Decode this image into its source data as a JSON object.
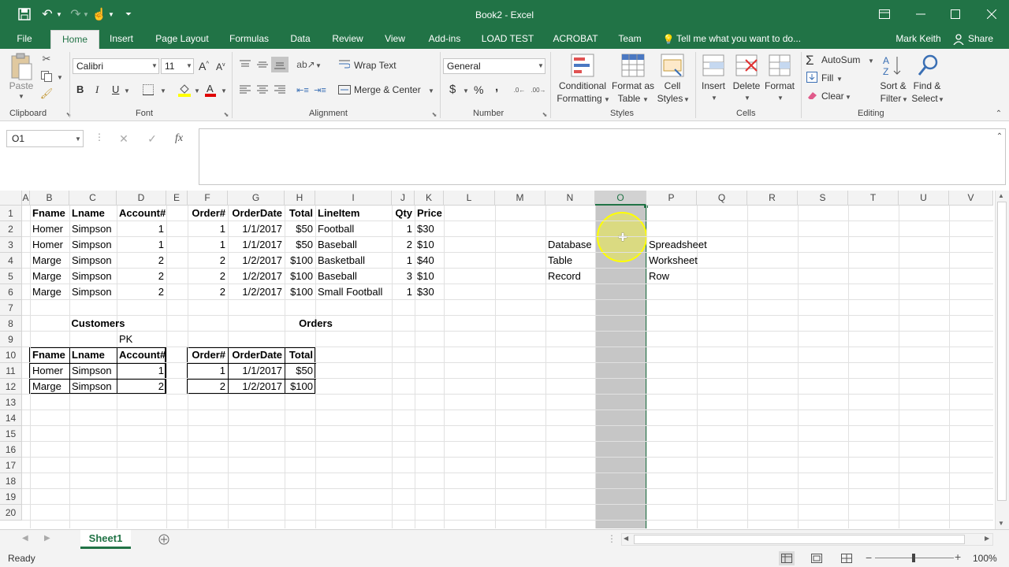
{
  "window": {
    "title": "Book2 - Excel",
    "user": "Mark Keith",
    "share": "Share"
  },
  "tabs": [
    "File",
    "Home",
    "Insert",
    "Page Layout",
    "Formulas",
    "Data",
    "Review",
    "View",
    "Add-ins",
    "LOAD TEST",
    "ACROBAT",
    "Team"
  ],
  "tell_me": "Tell me what you want to do...",
  "ribbon": {
    "clipboard": {
      "label": "Clipboard",
      "paste": "Paste"
    },
    "font": {
      "label": "Font",
      "name": "Calibri",
      "size": "11",
      "bold": "B",
      "italic": "I",
      "underline": "U"
    },
    "alignment": {
      "label": "Alignment",
      "wrap": "Wrap Text",
      "merge": "Merge & Center"
    },
    "number": {
      "label": "Number",
      "format": "General",
      "currency": "$",
      "percent": "%",
      "comma": ","
    },
    "styles": {
      "label": "Styles",
      "cond1": "Conditional",
      "cond2": "Formatting",
      "fmt1": "Format as",
      "fmt2": "Table",
      "cell1": "Cell",
      "cell2": "Styles"
    },
    "cells": {
      "label": "Cells",
      "insert": "Insert",
      "delete": "Delete",
      "format": "Format"
    },
    "editing": {
      "label": "Editing",
      "autosum": "AutoSum",
      "fill": "Fill",
      "clear": "Clear",
      "sort1": "Sort &",
      "sort2": "Filter",
      "find1": "Find &",
      "find2": "Select"
    }
  },
  "formula_bar": {
    "name_box": "O1",
    "fx": "fx",
    "value": ""
  },
  "columns": [
    "A",
    "B",
    "C",
    "D",
    "E",
    "F",
    "G",
    "H",
    "I",
    "J",
    "K",
    "L",
    "M",
    "N",
    "O",
    "P",
    "Q",
    "R",
    "S",
    "T",
    "U",
    "V"
  ],
  "rows": [
    "1",
    "2",
    "3",
    "4",
    "5",
    "6",
    "7",
    "8",
    "9",
    "10",
    "11",
    "12",
    "13",
    "14",
    "15",
    "16",
    "17",
    "18",
    "19",
    "20"
  ],
  "cells": {
    "B1": "Fname",
    "C1": "Lname",
    "D1": "Account#",
    "F1": "Order#",
    "G1": "OrderDate",
    "H1": "Total",
    "I1": "LineItem",
    "J1": "Qty",
    "K1": "Price",
    "B2": "Homer",
    "C2": "Simpson",
    "D2": "1",
    "F2": "1",
    "G2": "1/1/2017",
    "H2": "$50",
    "I2": "Football",
    "J2": "1",
    "K2": "$30",
    "B3": "Homer",
    "C3": "Simpson",
    "D3": "1",
    "F3": "1",
    "G3": "1/1/2017",
    "H3": "$50",
    "I3": "Baseball",
    "J3": "2",
    "K3": "$10",
    "B4": "Marge",
    "C4": "Simpson",
    "D4": "2",
    "F4": "2",
    "G4": "1/2/2017",
    "H4": "$100",
    "I4": "Basketball",
    "J4": "1",
    "K4": "$40",
    "B5": "Marge",
    "C5": "Simpson",
    "D5": "2",
    "F5": "2",
    "G5": "1/2/2017",
    "H5": "$100",
    "I5": "Baseball",
    "J5": "3",
    "K5": "$10",
    "B6": "Marge",
    "C6": "Simpson",
    "D6": "2",
    "F6": "2",
    "G6": "1/2/2017",
    "H6": "$100",
    "I6": "Small Football",
    "J6": "1",
    "K6": "$30",
    "N3": "Database",
    "P3": "Spreadsheet",
    "N4": "Table",
    "P4": "Worksheet",
    "N5": "Record",
    "P5": "Row",
    "C8": "Customers",
    "H8": "Orders",
    "D9": "PK",
    "B10": "Fname",
    "C10": "Lname",
    "D10": "Account#",
    "F10": "Order#",
    "G10": "OrderDate",
    "H10": "Total",
    "B11": "Homer",
    "C11": "Simpson",
    "D11": "1",
    "F11": "1",
    "G11": "1/1/2017",
    "H11": "$50",
    "B12": "Marge",
    "C12": "Simpson",
    "D12": "2",
    "F12": "2",
    "G12": "1/2/2017",
    "H12": "$100"
  },
  "selected_column": "O",
  "sheet_tab": "Sheet1",
  "status": {
    "ready": "Ready",
    "zoom": "100%"
  },
  "colors": {
    "excel_green": "#217346",
    "selection": "#c6c6c6",
    "highlight": "#ffff00"
  }
}
